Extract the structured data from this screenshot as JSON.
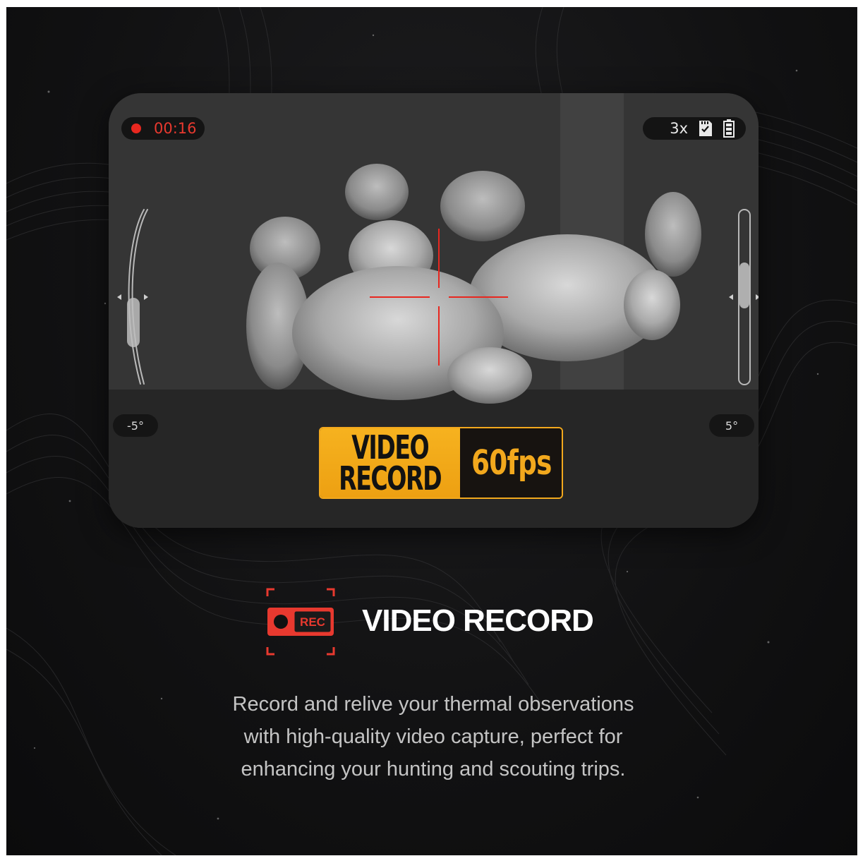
{
  "viewfinder": {
    "record_time": "00:16",
    "zoom": "3x",
    "tilt_left": "-5°",
    "tilt_right": "5°",
    "badge": {
      "line1": "VIDEO",
      "line2": "RECORD",
      "fps": "60fps"
    }
  },
  "feature": {
    "icon_label": "REC",
    "title": "VIDEO RECORD",
    "description": [
      "Record and relive your thermal observations",
      "with high-quality video capture, perfect for",
      "enhancing your hunting and scouting trips."
    ]
  },
  "colors": {
    "accent_red": "#e8271f",
    "badge_orange": "#f6b21f",
    "background": "#111112"
  },
  "icons": [
    "record-dot-icon",
    "sd-card-icon",
    "battery-icon",
    "crosshair-icon",
    "rec-camera-icon"
  ]
}
